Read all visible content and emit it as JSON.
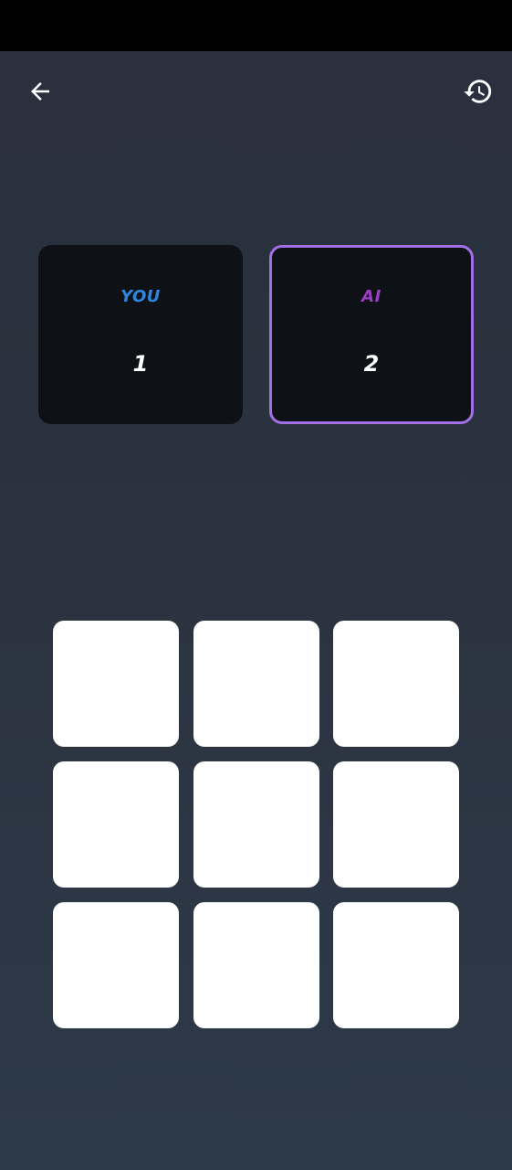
{
  "header": {
    "back_icon": "arrow-left-icon",
    "history_icon": "history-icon"
  },
  "scores": {
    "player": {
      "label": "YOU",
      "value": "1",
      "color": "#2e86e0"
    },
    "ai": {
      "label": "AI",
      "value": "2",
      "color": "#9a3fc4",
      "active_border": "#a46ee6"
    }
  },
  "board": {
    "cells": [
      "",
      "",
      "",
      "",
      "",
      "",
      "",
      "",
      ""
    ]
  },
  "colors": {
    "background": "#2b3240",
    "card": "#0e1216",
    "cell": "#ffffff"
  }
}
